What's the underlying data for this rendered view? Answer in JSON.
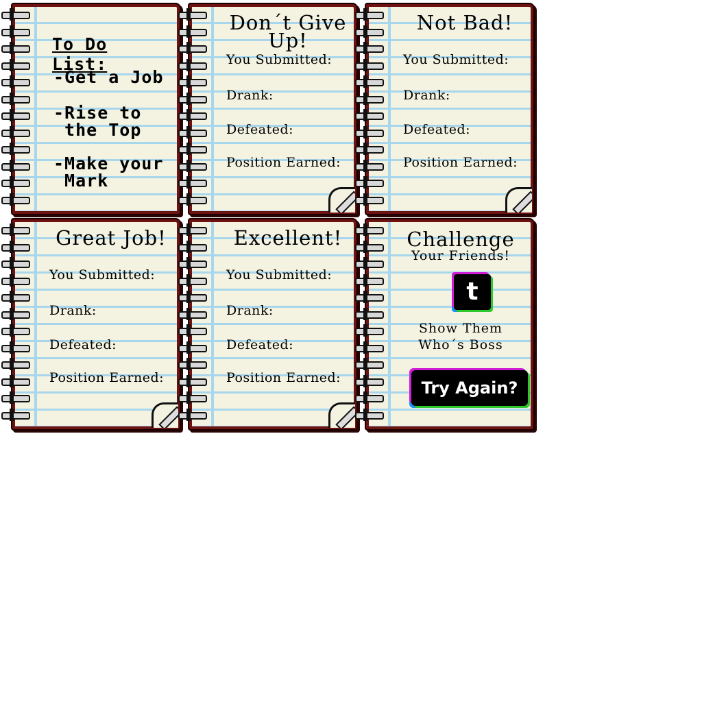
{
  "todo": {
    "title": "To Do List:",
    "items": [
      "-Get a Job",
      "-Rise to\n the Top",
      "-Make your\n Mark"
    ]
  },
  "result_cards": [
    {
      "title_line1": "Don´t Give",
      "title_line2": "Up!",
      "submitted": "You Submitted:",
      "drank": "Drank:",
      "defeated": "Defeated:",
      "position": "Position Earned:"
    },
    {
      "title_line1": "Not Bad!",
      "submitted": "You Submitted:",
      "drank": "Drank:",
      "defeated": "Defeated:",
      "position": "Position Earned:"
    },
    {
      "title_line1": "Great Job!",
      "submitted": "You Submitted:",
      "drank": "Drank:",
      "defeated": "Defeated:",
      "position": "Position Earned:"
    },
    {
      "title_line1": "Excellent!",
      "submitted": "You Submitted:",
      "drank": "Drank:",
      "defeated": "Defeated:",
      "position": "Position Earned:"
    }
  ],
  "challenge": {
    "title": "Challenge",
    "subtitle": "Your Friends!",
    "twitter_icon_glyph": "t",
    "tagline_line1": "Show Them",
    "tagline_line2": "Who´s Boss",
    "button_label": "Try Again?"
  },
  "icons": [
    "spiral-ring-icon",
    "pencil-icon",
    "twitter-icon"
  ],
  "colors": {
    "paper": "#f4f3e2",
    "rule_line": "#a8d6ec",
    "cover": "#6e1212",
    "button": "#000000"
  }
}
